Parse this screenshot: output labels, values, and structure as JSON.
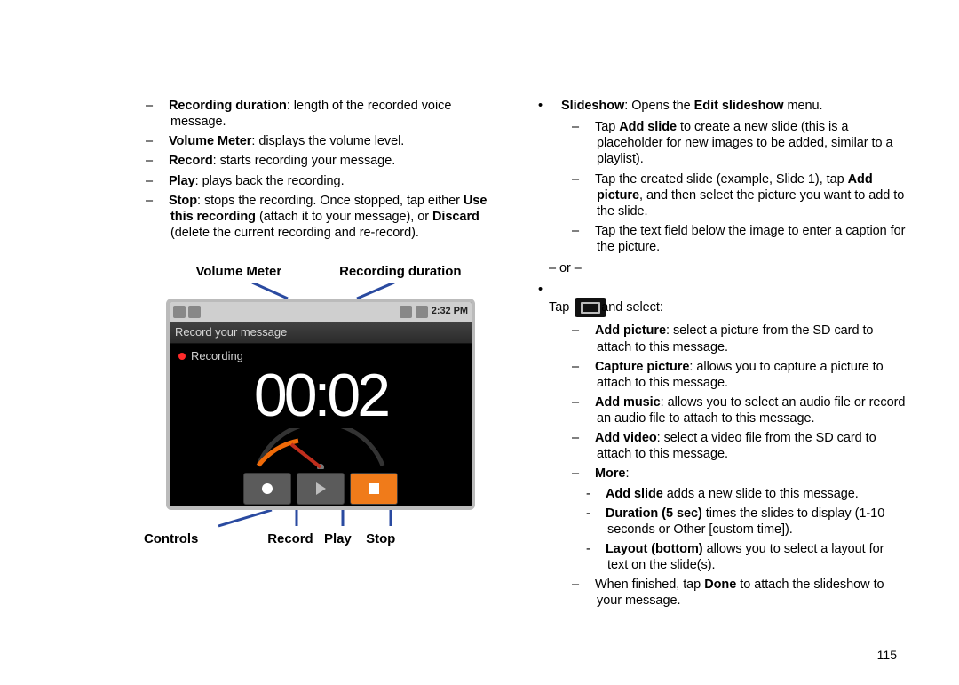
{
  "page_number": "115",
  "left_col": {
    "items": [
      {
        "b": "Recording duration",
        "t": ": length of the recorded voice message."
      },
      {
        "b": "Volume Meter",
        "t": ": displays the volume level."
      },
      {
        "b": "Record",
        "t": ": starts recording your message."
      },
      {
        "b": "Play",
        "t": ": plays back the recording."
      },
      {
        "b": "Stop",
        "t": ": stops the recording. Once stopped, tap either ",
        "b2": "Use this recording",
        "t2": " (attach it to your message), or ",
        "b3": "Discard",
        "t3": " (delete the current recording and re-record)."
      }
    ],
    "top_labels": {
      "l1": "Volume Meter",
      "l2": "Recording duration"
    },
    "phone": {
      "clock": "2:32 PM",
      "title": "Record your message",
      "status": "Recording",
      "timer": "00:02"
    },
    "bottom_labels": {
      "controls": "Controls",
      "record": "Record",
      "play": "Play",
      "stop": "Stop"
    }
  },
  "right_col": {
    "slideshow_line": {
      "b": "Slideshow",
      "t": ": Opens the ",
      "b2": "Edit slideshow",
      "t2": " menu."
    },
    "slideshow_sub": [
      {
        "pre": "Tap ",
        "b": "Add slide",
        "t": " to create a new slide (this is a placeholder for new images to be added, similar to a playlist)."
      },
      {
        "pre": "Tap the created slide (example, Slide 1), tap ",
        "b": "Add picture",
        "t": ", and then select the picture you want to add to the slide."
      },
      {
        "pre": "",
        "b": "",
        "t": "Tap the text field below the image to enter a caption for the picture."
      }
    ],
    "or": "– or –",
    "tap": {
      "pre": "Tap ",
      "post": "and select:"
    },
    "menu_sub": [
      {
        "b": "Add picture",
        "t": ": select a picture from the SD card to attach to this message."
      },
      {
        "b": "Capture picture",
        "t": ": allows you to capture a picture to attach to this message."
      },
      {
        "b": "Add music",
        "t": ": allows you to select an audio file or record an audio file to attach to this message."
      },
      {
        "b": "Add video",
        "t": ": select a video file from the SD card to attach to this message."
      },
      {
        "b": "More",
        "t": ":"
      }
    ],
    "more_sub": [
      {
        "b": "Add slide",
        "t": " adds a new slide to this message."
      },
      {
        "b": "Duration (5 sec)",
        "t": " times the slides to display (1-10 seconds or Other [custom time])."
      },
      {
        "b": "Layout (bottom)",
        "t": " allows you to select a layout for text on the slide(s)."
      }
    ],
    "done_line": {
      "pre": "When finished, tap ",
      "b": "Done",
      "t": " to attach the slideshow to your message."
    }
  }
}
